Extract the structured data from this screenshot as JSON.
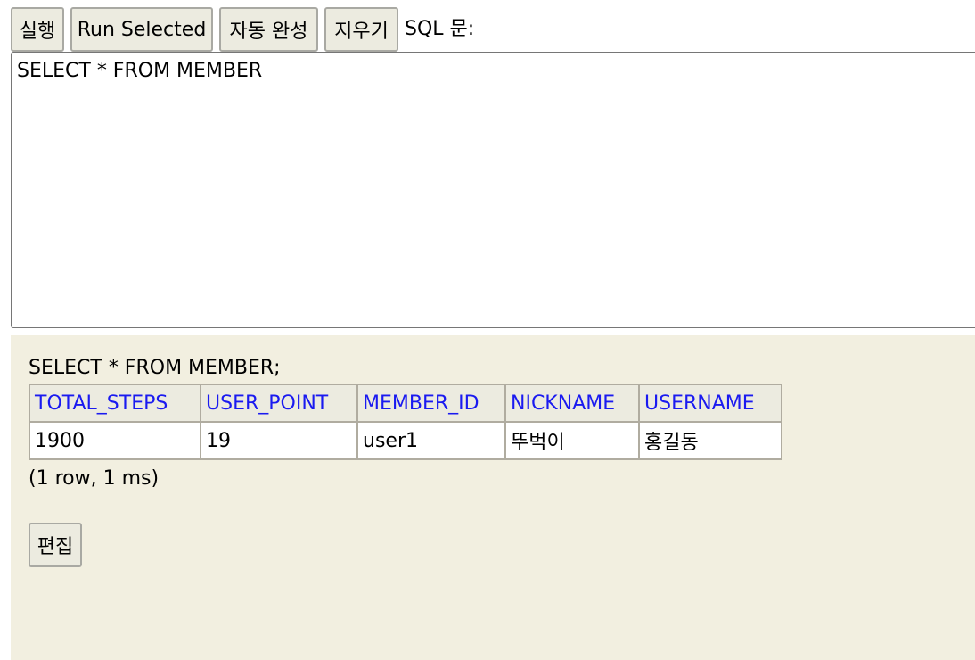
{
  "toolbar": {
    "run_label": "실행",
    "run_selected_label": "Run Selected",
    "autocomplete_label": "자동 완성",
    "clear_label": "지우기",
    "sql_label": "SQL 문:"
  },
  "editor": {
    "value": "SELECT * FROM MEMBER"
  },
  "result": {
    "query_text": "SELECT * FROM MEMBER;",
    "columns": [
      "TOTAL_STEPS",
      "USER_POINT",
      "MEMBER_ID",
      "NICKNAME",
      "USERNAME"
    ],
    "rows": [
      [
        "1900",
        "19",
        "user1",
        "뚜벅이",
        "홍길동"
      ]
    ],
    "status": "(1 row, 1 ms)",
    "edit_label": "편집"
  },
  "colors": {
    "panel_background": "#f2efe0",
    "header_text": "#1a1af0",
    "button_background": "#ecebe0"
  }
}
